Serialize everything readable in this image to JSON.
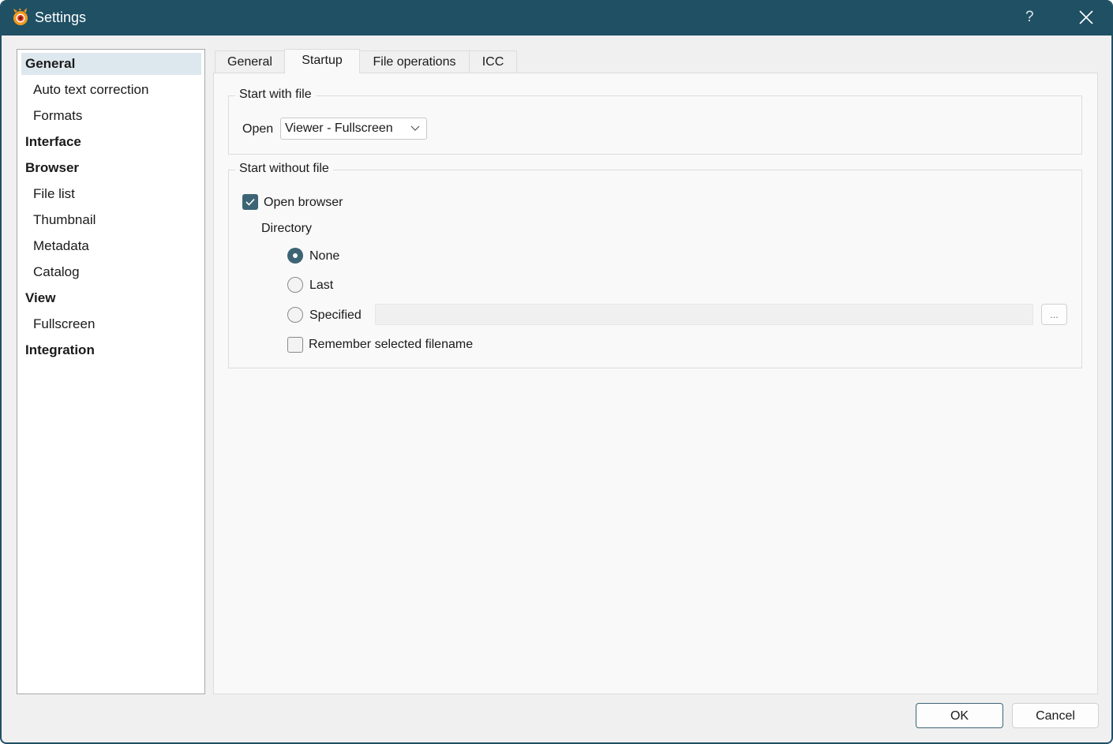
{
  "window": {
    "title": "Settings",
    "help": "?"
  },
  "sidebar": {
    "items": [
      {
        "label": "General",
        "level": 0
      },
      {
        "label": "Auto text correction",
        "level": 1
      },
      {
        "label": "Formats",
        "level": 1
      },
      {
        "label": "Interface",
        "level": 0
      },
      {
        "label": "Browser",
        "level": 0
      },
      {
        "label": "File list",
        "level": 1
      },
      {
        "label": "Thumbnail",
        "level": 1
      },
      {
        "label": "Metadata",
        "level": 1
      },
      {
        "label": "Catalog",
        "level": 1
      },
      {
        "label": "View",
        "level": 0
      },
      {
        "label": "Fullscreen",
        "level": 1
      },
      {
        "label": "Integration",
        "level": 0
      }
    ]
  },
  "tabs": [
    "General",
    "Startup",
    "File operations",
    "ICC"
  ],
  "start_with_file": {
    "title": "Start with file",
    "open_label": "Open",
    "open_value": "Viewer - Fullscreen"
  },
  "start_without_file": {
    "title": "Start without file",
    "open_browser": "Open browser",
    "directory": "Directory",
    "none": "None",
    "last": "Last",
    "specified": "Specified",
    "specified_value": "",
    "browse": "...",
    "remember": "Remember selected filename"
  },
  "buttons": {
    "ok": "OK",
    "cancel": "Cancel"
  },
  "colors": {
    "titlebar": "#1f5064",
    "accent": "#3d6475"
  }
}
